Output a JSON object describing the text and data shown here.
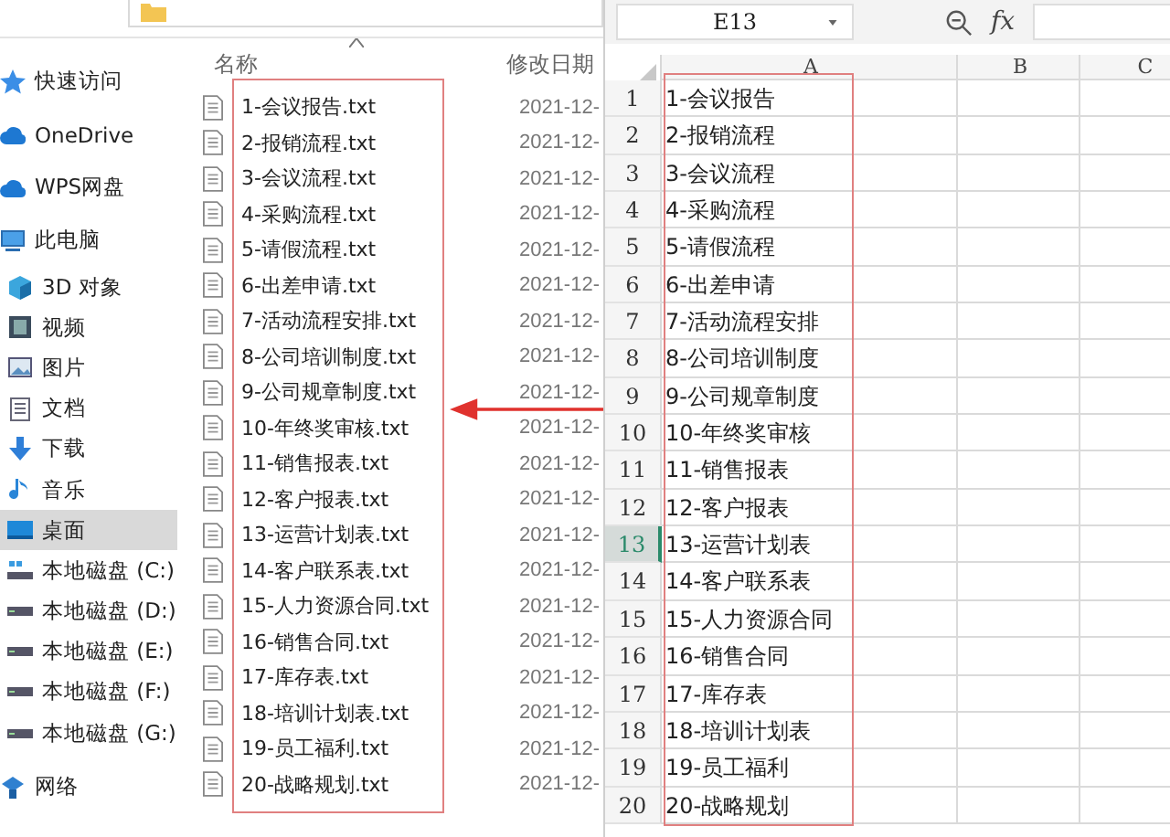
{
  "explorer": {
    "sidebar": {
      "items": [
        {
          "label": "快速访问",
          "selected": false
        },
        {
          "label": "OneDrive",
          "selected": false
        },
        {
          "label": "WPS网盘",
          "selected": false
        },
        {
          "label": "此电脑",
          "selected": false,
          "children": [
            {
              "label": "3D 对象",
              "selected": false
            },
            {
              "label": "视频",
              "selected": false
            },
            {
              "label": "图片",
              "selected": false
            },
            {
              "label": "文档",
              "selected": false
            },
            {
              "label": "下载",
              "selected": false
            },
            {
              "label": "音乐",
              "selected": false
            },
            {
              "label": "桌面",
              "selected": true
            },
            {
              "label": "本地磁盘 (C:)",
              "selected": false
            },
            {
              "label": "本地磁盘 (D:)",
              "selected": false
            },
            {
              "label": "本地磁盘 (E:)",
              "selected": false
            },
            {
              "label": "本地磁盘 (F:)",
              "selected": false
            },
            {
              "label": "本地磁盘 (G:)",
              "selected": false
            }
          ]
        },
        {
          "label": "网络",
          "selected": false
        }
      ]
    },
    "file_list": {
      "columns": [
        "名称",
        "修改日期"
      ],
      "files": [
        {
          "name": "1-会议报告.txt",
          "modified": "2021-12-"
        },
        {
          "name": "2-报销流程.txt",
          "modified": "2021-12-"
        },
        {
          "name": "3-会议流程.txt",
          "modified": "2021-12-"
        },
        {
          "name": "4-采购流程.txt",
          "modified": "2021-12-"
        },
        {
          "name": "5-请假流程.txt",
          "modified": "2021-12-"
        },
        {
          "name": "6-出差申请.txt",
          "modified": "2021-12-"
        },
        {
          "name": "7-活动流程安排.txt",
          "modified": "2021-12-"
        },
        {
          "name": "8-公司培训制度.txt",
          "modified": "2021-12-"
        },
        {
          "name": "9-公司规章制度.txt",
          "modified": "2021-12-"
        },
        {
          "name": "10-年终奖审核.txt",
          "modified": "2021-12-"
        },
        {
          "name": "11-销售报表.txt",
          "modified": "2021-12-"
        },
        {
          "name": "12-客户报表.txt",
          "modified": "2021-12-"
        },
        {
          "name": "13-运营计划表.txt",
          "modified": "2021-12-"
        },
        {
          "name": "14-客户联系表.txt",
          "modified": "2021-12-"
        },
        {
          "name": "15-人力资源合同.txt",
          "modified": "2021-12-"
        },
        {
          "name": "16-销售合同.txt",
          "modified": "2021-12-"
        },
        {
          "name": "17-库存表.txt",
          "modified": "2021-12-"
        },
        {
          "name": "18-培训计划表.txt",
          "modified": "2021-12-"
        },
        {
          "name": "19-员工福利.txt",
          "modified": "2021-12-"
        },
        {
          "name": "20-战略规划.txt",
          "modified": "2021-12-"
        }
      ]
    }
  },
  "spreadsheet": {
    "name_box": "E13",
    "formula_label": "fx",
    "columns": [
      "A",
      "B",
      "C"
    ],
    "rows": [
      {
        "number": "1",
        "cells": [
          "1-会议报告"
        ],
        "selected": false
      },
      {
        "number": "2",
        "cells": [
          "2-报销流程"
        ],
        "selected": false
      },
      {
        "number": "3",
        "cells": [
          "3-会议流程"
        ],
        "selected": false
      },
      {
        "number": "4",
        "cells": [
          "4-采购流程"
        ],
        "selected": false
      },
      {
        "number": "5",
        "cells": [
          "5-请假流程"
        ],
        "selected": false
      },
      {
        "number": "6",
        "cells": [
          "6-出差申请"
        ],
        "selected": false
      },
      {
        "number": "7",
        "cells": [
          "7-活动流程安排"
        ],
        "selected": false
      },
      {
        "number": "8",
        "cells": [
          "8-公司培训制度"
        ],
        "selected": false
      },
      {
        "number": "9",
        "cells": [
          "9-公司规章制度"
        ],
        "selected": false
      },
      {
        "number": "10",
        "cells": [
          "10-年终奖审核"
        ],
        "selected": false
      },
      {
        "number": "11",
        "cells": [
          "11-销售报表"
        ],
        "selected": false
      },
      {
        "number": "12",
        "cells": [
          "12-客户报表"
        ],
        "selected": false
      },
      {
        "number": "13",
        "cells": [
          "13-运营计划表"
        ],
        "selected": true
      },
      {
        "number": "14",
        "cells": [
          "14-客户联系表"
        ],
        "selected": false
      },
      {
        "number": "15",
        "cells": [
          "15-人力资源合同"
        ],
        "selected": false
      },
      {
        "number": "16",
        "cells": [
          "16-销售合同"
        ],
        "selected": false
      },
      {
        "number": "17",
        "cells": [
          "17-库存表"
        ],
        "selected": false
      },
      {
        "number": "18",
        "cells": [
          "18-培训计划表"
        ],
        "selected": false
      },
      {
        "number": "19",
        "cells": [
          "19-员工福利"
        ],
        "selected": false
      },
      {
        "number": "20",
        "cells": [
          "20-战略规划"
        ],
        "selected": false
      }
    ]
  }
}
